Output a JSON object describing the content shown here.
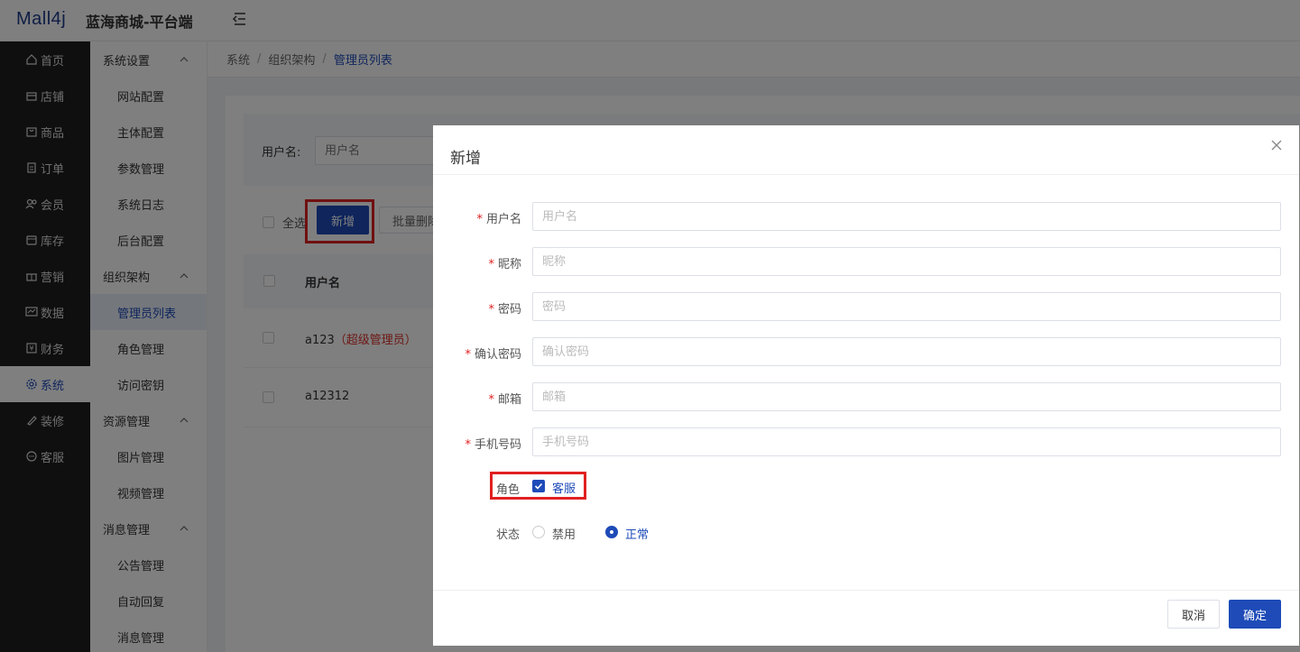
{
  "header": {
    "logo": "Mall4j",
    "brand": "蓝海商城-平台端"
  },
  "sidebar_main": [
    {
      "label": "首页",
      "icon": "home-icon"
    },
    {
      "label": "店铺",
      "icon": "shop-icon"
    },
    {
      "label": "商品",
      "icon": "goods-icon"
    },
    {
      "label": "订单",
      "icon": "order-icon"
    },
    {
      "label": "会员",
      "icon": "member-icon"
    },
    {
      "label": "库存",
      "icon": "stock-icon"
    },
    {
      "label": "营销",
      "icon": "gift-icon"
    },
    {
      "label": "数据",
      "icon": "chart-icon"
    },
    {
      "label": "财务",
      "icon": "finance-icon"
    },
    {
      "label": "系统",
      "icon": "gear-icon",
      "active": true
    },
    {
      "label": "装修",
      "icon": "brush-icon"
    },
    {
      "label": "客服",
      "icon": "chat-icon"
    }
  ],
  "sidebar_sub": {
    "g1": "系统设置",
    "g1_items": [
      "网站配置",
      "主体配置",
      "参数管理",
      "系统日志",
      "后台配置"
    ],
    "g2": "组织架构",
    "g2_items": [
      "管理员列表",
      "角色管理",
      "访问密钥"
    ],
    "g3": "资源管理",
    "g3_items": [
      "图片管理",
      "视频管理"
    ],
    "g4": "消息管理",
    "g4_items": [
      "公告管理",
      "自动回复",
      "消息管理"
    ]
  },
  "breadcrumb": {
    "a": "系统",
    "b": "组织架构",
    "c": "管理员列表",
    "sep": "/"
  },
  "search": {
    "label": "用户名:",
    "placeholder": "用户名"
  },
  "toolbar": {
    "select_all": "全选",
    "add": "新增",
    "batch_delete": "批量删除"
  },
  "table": {
    "col_username": "用户名",
    "rows": [
      {
        "name": "a123",
        "tag": "（超级管理员）"
      },
      {
        "name": "a12312",
        "tag": ""
      }
    ]
  },
  "dialog": {
    "title": "新增",
    "fields": [
      {
        "label": "用户名",
        "placeholder": "用户名"
      },
      {
        "label": "昵称",
        "placeholder": "昵称"
      },
      {
        "label": "密码",
        "placeholder": "密码"
      },
      {
        "label": "确认密码",
        "placeholder": "确认密码"
      },
      {
        "label": "邮箱",
        "placeholder": "邮箱"
      },
      {
        "label": "手机号码",
        "placeholder": "手机号码"
      }
    ],
    "required_mark": "*",
    "role_label": "角色",
    "role_option": "客服",
    "status_label": "状态",
    "status_disabled": "禁用",
    "status_normal": "正常",
    "cancel": "取消",
    "confirm": "确定"
  },
  "colors": {
    "primary": "#1e4bb8",
    "highlight": "#e02020",
    "sidebar": "#1f1f1f"
  }
}
